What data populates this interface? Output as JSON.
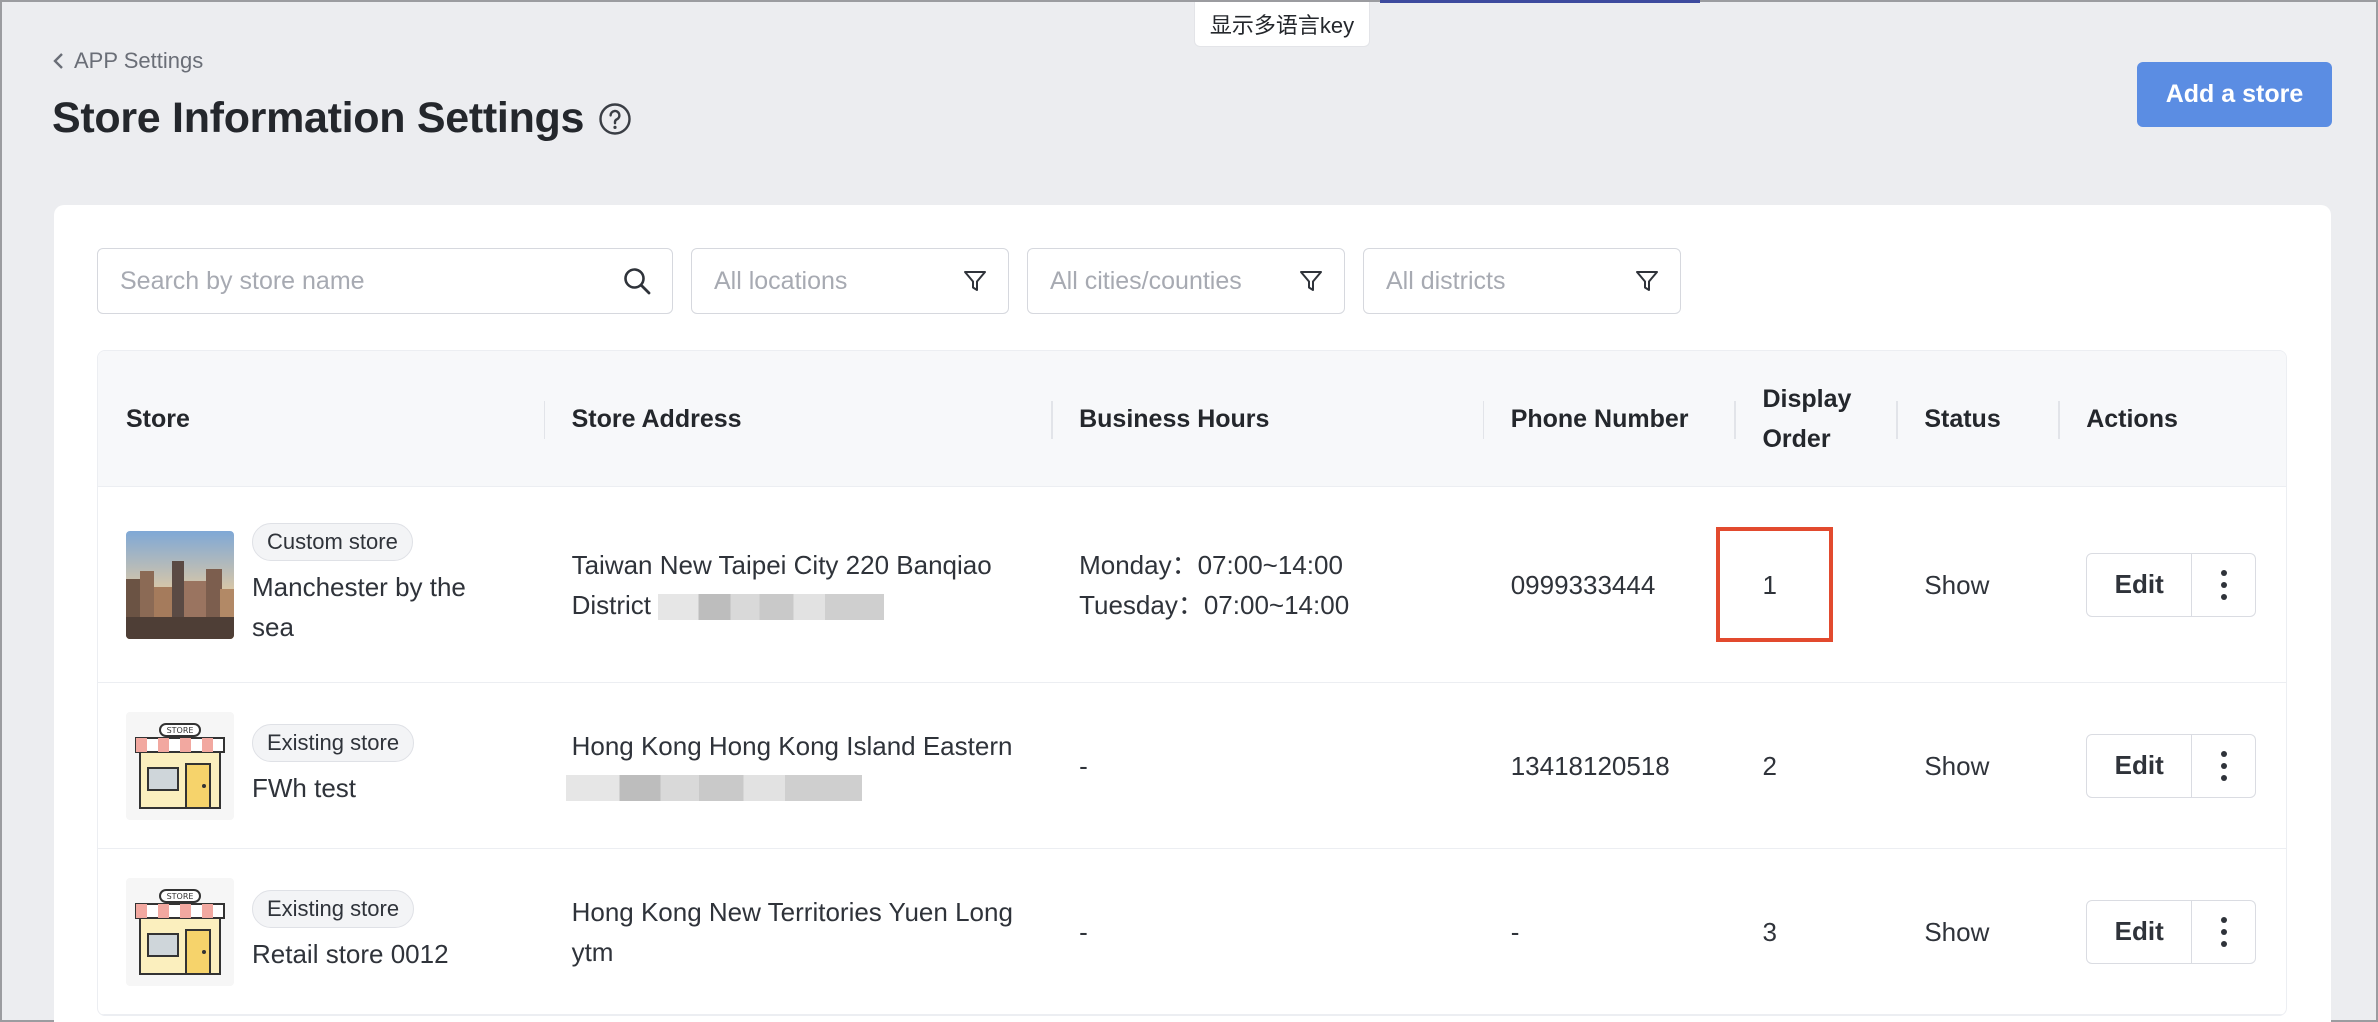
{
  "lang_badge": "显示多语言key",
  "breadcrumb": {
    "label": "APP Settings"
  },
  "page": {
    "title": "Store Information Settings",
    "add_button": "Add a store"
  },
  "filters": {
    "search_placeholder": "Search by store name",
    "locations_placeholder": "All locations",
    "cities_placeholder": "All cities/counties",
    "districts_placeholder": "All districts"
  },
  "table": {
    "headers": {
      "store": "Store",
      "address": "Store Address",
      "hours": "Business Hours",
      "phone": "Phone Number",
      "order_line1": "Display",
      "order_line2": "Order",
      "status": "Status",
      "actions": "Actions"
    },
    "rows": [
      {
        "tag": "Custom store",
        "name": "Manchester by the sea",
        "address_line1": "Taiwan New Taipei City 220 Banqiao",
        "address_line2": "District",
        "hours_line1": "Monday：07:00~14:00",
        "hours_line2": "Tuesday：07:00~14:00",
        "phone": "0999333444",
        "order": "1",
        "status": "Show",
        "edit": "Edit"
      },
      {
        "tag": "Existing store",
        "name": "FWh test",
        "address_line1": "Hong Kong Hong Kong Island Eastern",
        "hours": "-",
        "phone": "13418120518",
        "order": "2",
        "status": "Show",
        "edit": "Edit"
      },
      {
        "tag": "Existing store",
        "name": "Retail store 0012",
        "address_line1": "Hong Kong New Territories Yuen Long",
        "address_line2": "ytm",
        "hours": "-",
        "phone": "-",
        "order": "3",
        "status": "Show",
        "edit": "Edit"
      }
    ]
  },
  "colors": {
    "accent": "#5b8de3",
    "highlight": "#e24a2e"
  }
}
